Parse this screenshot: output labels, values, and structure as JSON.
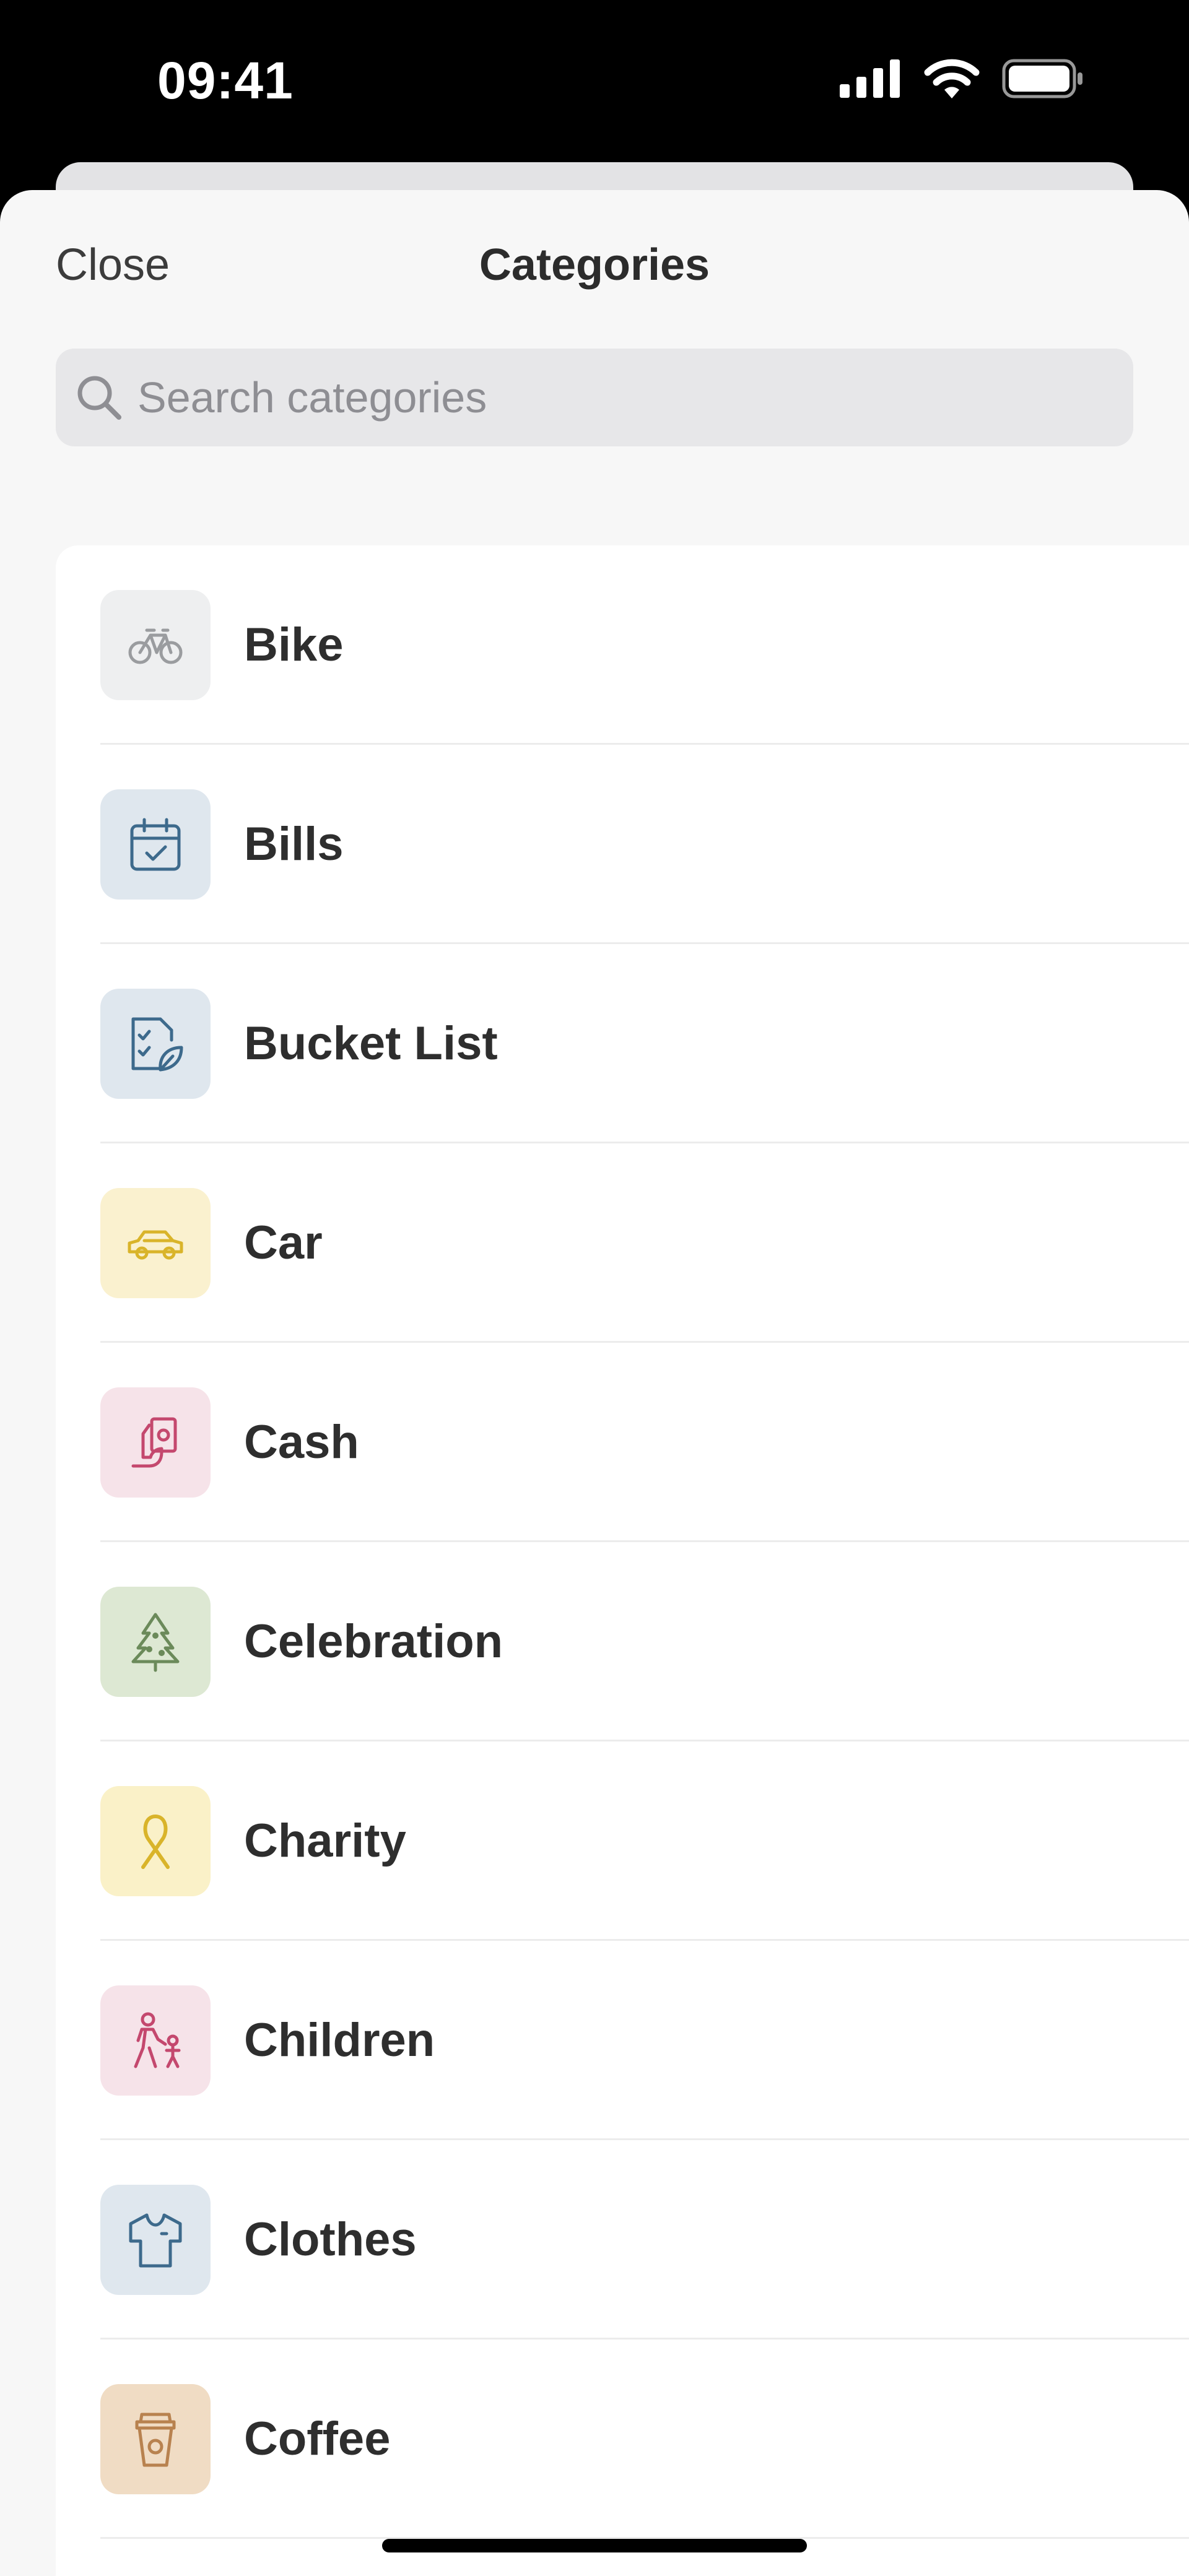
{
  "status_bar": {
    "time": "09:41",
    "icons": [
      "cellular-signal-icon",
      "wifi-icon",
      "battery-icon"
    ]
  },
  "header": {
    "close_label": "Close",
    "title": "Categories"
  },
  "search": {
    "placeholder": "Search categories",
    "value": ""
  },
  "categories": [
    {
      "label": "Bike",
      "icon": "bike-icon",
      "bg": "#eeeff0",
      "color": "#9a9c9f"
    },
    {
      "label": "Bills",
      "icon": "calendar-check-icon",
      "bg": "#dfe7ee",
      "color": "#3d6a8c"
    },
    {
      "label": "Bucket List",
      "icon": "checklist-leaf-icon",
      "bg": "#dfe7ee",
      "color": "#3d6a8c"
    },
    {
      "label": "Car",
      "icon": "car-icon",
      "bg": "#faf1cf",
      "color": "#d9b42a"
    },
    {
      "label": "Cash",
      "icon": "cash-hand-icon",
      "bg": "#f6e3e9",
      "color": "#c4486e"
    },
    {
      "label": "Celebration",
      "icon": "christmas-tree-icon",
      "bg": "#dde8d3",
      "color": "#6b8a5a"
    },
    {
      "label": "Charity",
      "icon": "ribbon-icon",
      "bg": "#faf1c8",
      "color": "#d9b42a"
    },
    {
      "label": "Children",
      "icon": "parent-child-icon",
      "bg": "#f6e3e9",
      "color": "#c4486e"
    },
    {
      "label": "Clothes",
      "icon": "shirt-icon",
      "bg": "#dfe7ee",
      "color": "#3d6a8c"
    },
    {
      "label": "Coffee",
      "icon": "coffee-cup-icon",
      "bg": "#f0dcc4",
      "color": "#b8824f"
    }
  ]
}
